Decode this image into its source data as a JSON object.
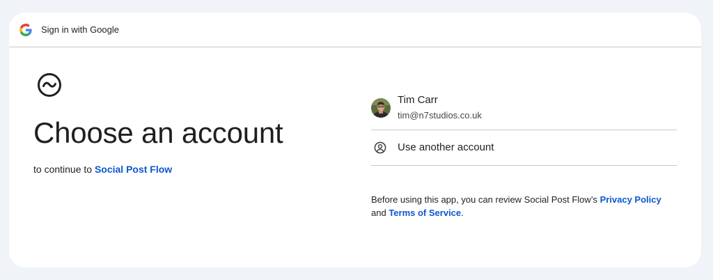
{
  "header": {
    "title": "Sign in with Google",
    "logo_icon": "google-g-icon"
  },
  "main": {
    "app_logo_icon": "tilde-circle-icon",
    "heading": "Choose an account",
    "continue_prefix": "to continue to",
    "app_name": "Social Post Flow"
  },
  "accounts": [
    {
      "name": "Tim Carr",
      "email": "tim@n7studios.co.uk",
      "avatar_icon": "avatar-photo"
    }
  ],
  "other_account": {
    "label": "Use another account",
    "icon": "person-circle-icon"
  },
  "footnote": {
    "prefix": "Before using this app, you can review Social Post Flow’s",
    "privacy_link": "Privacy Policy",
    "and": "and",
    "terms_link": "Terms of Service",
    "suffix": "."
  },
  "colors": {
    "page_background": "#f0f4f9",
    "card_background": "#ffffff",
    "link": "#0b57d0",
    "divider": "#c7c7c7",
    "text": "#1f1f1f",
    "secondary_text": "#444746"
  }
}
